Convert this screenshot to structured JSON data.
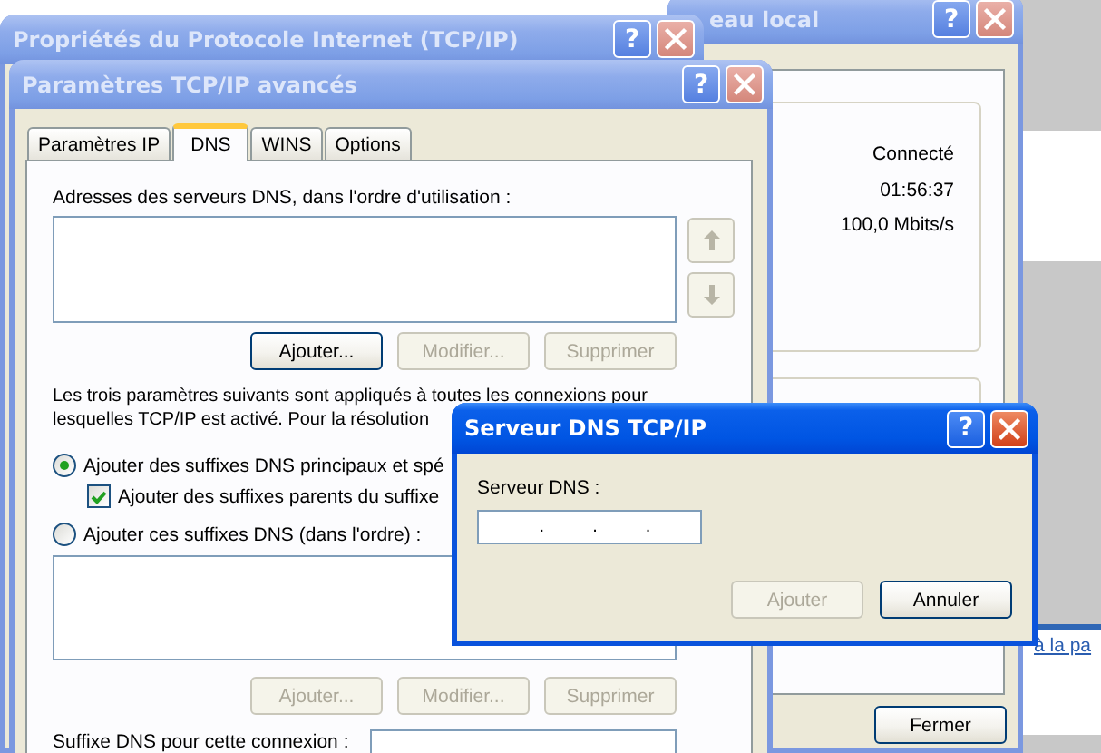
{
  "status_window": {
    "title": "eau local",
    "active": false,
    "help_button": "?",
    "values": [
      "Connecté",
      "01:56:37",
      "100,0 Mbits/s"
    ],
    "close_button": "Fermer"
  },
  "web_page": {
    "link": "à la pa"
  },
  "properties_window": {
    "title": "Propriétés du Protocole Internet (TCP/IP)",
    "active": false,
    "help_button": "?"
  },
  "advanced_window": {
    "title": "Paramètres TCP/IP avancés",
    "active": false,
    "help_button": "?",
    "tabs": [
      {
        "label": "Paramètres IP",
        "selected": false
      },
      {
        "label": "DNS",
        "selected": true
      },
      {
        "label": "WINS",
        "selected": false
      },
      {
        "label": "Options",
        "selected": false
      }
    ],
    "dns_list_label": "Adresses des serveurs DNS, dans l'ordre d'utilisation :",
    "move_buttons_disabled": true,
    "dns_buttons": [
      {
        "label": "Ajouter...",
        "disabled": false
      },
      {
        "label": "Modifier...",
        "disabled": true
      },
      {
        "label": "Supprimer",
        "disabled": true
      }
    ],
    "info_lines": [
      "Les trois paramètres suivants sont appliqués à toutes les connexions pour",
      "lesquelles TCP/IP est activé. Pour la résolution"
    ],
    "options": [
      {
        "kind": "radio",
        "label": "Ajouter des suffixes DNS principaux et spé",
        "selected": true
      },
      {
        "kind": "checkbox",
        "label": "Ajouter des suffixes parents du suffixe",
        "checked": true
      },
      {
        "kind": "radio",
        "label": "Ajouter ces suffixes DNS (dans l'ordre) :",
        "selected": false
      }
    ],
    "suffix_buttons": [
      {
        "label": "Ajouter...",
        "disabled": true
      },
      {
        "label": "Modifier...",
        "disabled": true
      },
      {
        "label": "Supprimer",
        "disabled": true
      }
    ],
    "connection_suffix_label": "Suffixe DNS pour cette connexion :"
  },
  "dns_dialog": {
    "title": "Serveur DNS TCP/IP",
    "active": true,
    "help_button": "?",
    "field_label": "Serveur DNS :",
    "ip_separators": [
      ".",
      ".",
      "."
    ],
    "buttons": [
      {
        "label": "Ajouter",
        "disabled": true
      },
      {
        "label": "Annuler",
        "disabled": false
      }
    ]
  }
}
